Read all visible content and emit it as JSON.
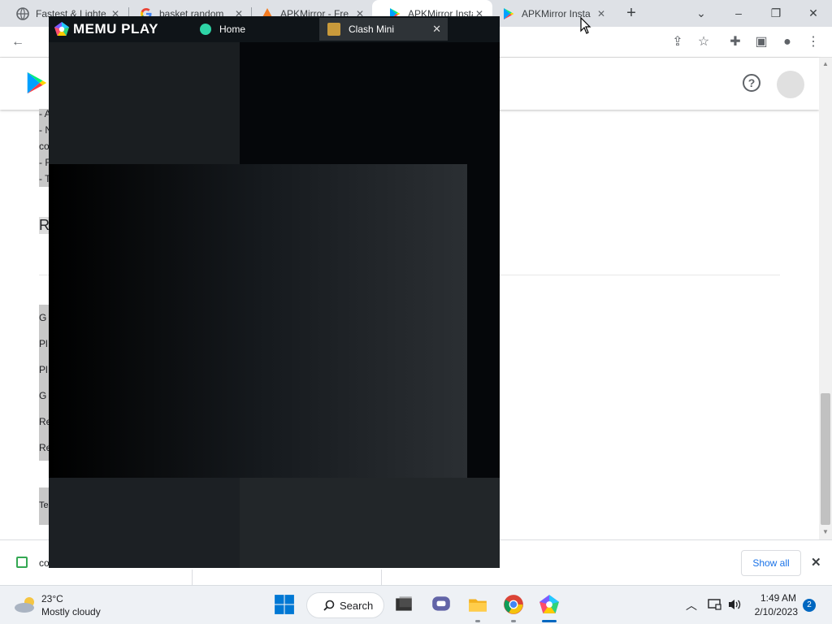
{
  "browser": {
    "tabs": [
      {
        "title": "Fastest & Lighte",
        "favicon": "globe-icon",
        "active": false
      },
      {
        "title": "basket random",
        "favicon": "google-g-icon",
        "active": false
      },
      {
        "title": "APKMirror - Fre",
        "favicon": "apkmirror-icon",
        "active": false
      },
      {
        "title": "APKMirror Insta",
        "favicon": "google-play-icon",
        "active": true
      },
      {
        "title": "APKMirror Insta",
        "favicon": "google-play-icon",
        "active": false
      }
    ],
    "new_tab_label": "+",
    "colors": {
      "tab_strip": "#dee1e6",
      "active_tab": "#ffffff"
    }
  },
  "page": {
    "ghost_fragments": [
      "- A",
      "- N",
      "co",
      "- R",
      "- T",
      "R",
      "G",
      "Pl",
      "Pl",
      "G",
      "Re",
      "Re",
      "Te"
    ]
  },
  "downloads": {
    "item_text": "co",
    "show_all_label": "Show all",
    "close_glyph": "✕"
  },
  "memu": {
    "brand": "MEMU PLAY",
    "tabs": [
      {
        "label": "Home",
        "icon": "memu-home-icon"
      },
      {
        "label": "Clash Mini",
        "icon": "clash-mini-icon",
        "active": true
      }
    ],
    "close_glyph": "✕",
    "colors": {
      "top_bar": "#0f1418",
      "active_tab": "#2e3337"
    }
  },
  "taskbar": {
    "weather": {
      "temp": "23°C",
      "desc": "Mostly cloudy"
    },
    "search_label": "Search",
    "clock": {
      "time": "1:49 AM",
      "date": "2/10/2023"
    },
    "notification_count": "2"
  }
}
